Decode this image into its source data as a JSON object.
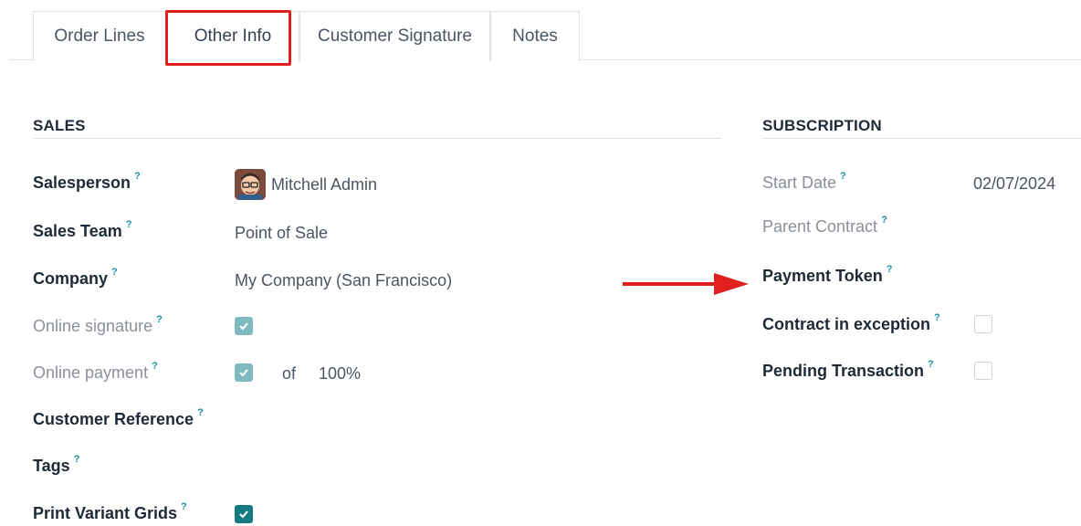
{
  "tabs": [
    {
      "label": "Order Lines"
    },
    {
      "label": "Other Info"
    },
    {
      "label": "Customer Signature"
    },
    {
      "label": "Notes"
    }
  ],
  "help_mark": "?",
  "sales": {
    "title": "SALES",
    "salesperson": {
      "label": "Salesperson",
      "value": "Mitchell Admin"
    },
    "sales_team": {
      "label": "Sales Team",
      "value": "Point of Sale"
    },
    "company": {
      "label": "Company",
      "value": "My Company (San Francisco)"
    },
    "online_signature": {
      "label": "Online signature",
      "checked": true
    },
    "online_payment": {
      "label": "Online payment",
      "checked": true,
      "of_text": "of",
      "percent": "100%"
    },
    "customer_reference": {
      "label": "Customer Reference"
    },
    "tags": {
      "label": "Tags"
    },
    "print_variant_grids": {
      "label": "Print Variant Grids",
      "checked": true
    }
  },
  "subscription": {
    "title": "SUBSCRIPTION",
    "start_date": {
      "label": "Start Date",
      "value": "02/07/2024"
    },
    "parent_contract": {
      "label": "Parent Contract"
    },
    "payment_token": {
      "label": "Payment Token"
    },
    "contract_in_exception": {
      "label": "Contract in exception",
      "checked": false
    },
    "pending_transaction": {
      "label": "Pending Transaction",
      "checked": false
    }
  },
  "colors": {
    "highlight": "#e01f1f",
    "checkbox_active": "#137a80",
    "checkbox_readonly": "#7fbac0",
    "help_mark": "#1b8fa6"
  },
  "annotations": {
    "tab_highlight": "red-rectangle-around-other-info-tab",
    "arrow": "red-arrow-pointing-to-payment-token"
  }
}
